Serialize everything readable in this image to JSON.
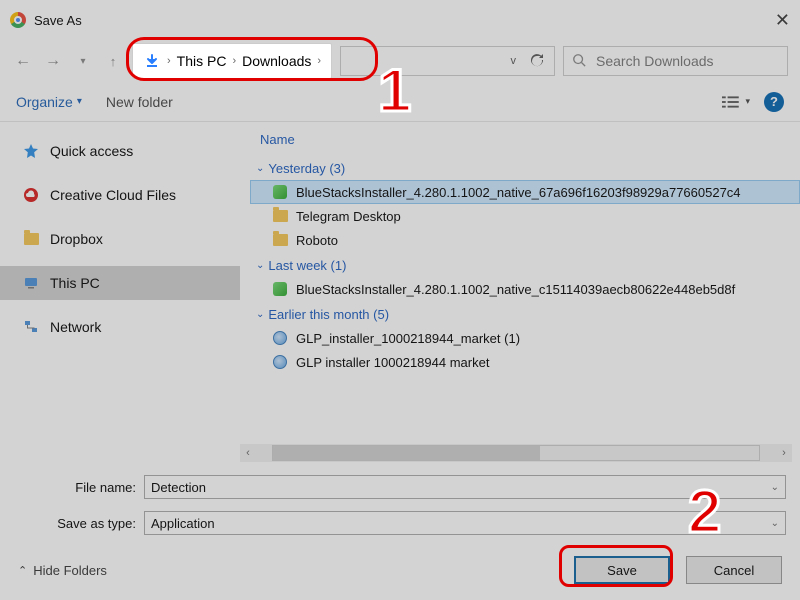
{
  "window": {
    "title": "Save As"
  },
  "breadcrumb": {
    "root": "This PC",
    "folder": "Downloads"
  },
  "search": {
    "placeholder": "Search Downloads"
  },
  "toolbar": {
    "organize": "Organize",
    "newfolder": "New folder"
  },
  "sidebar": {
    "items": [
      {
        "label": "Quick access",
        "icon": "star"
      },
      {
        "label": "Creative Cloud Files",
        "icon": "cc"
      },
      {
        "label": "Dropbox",
        "icon": "folder"
      },
      {
        "label": "This PC",
        "icon": "pc",
        "selected": true
      },
      {
        "label": "Network",
        "icon": "network"
      }
    ]
  },
  "list": {
    "column": "Name",
    "groups": [
      {
        "label": "Yesterday (3)",
        "items": [
          {
            "name": "BlueStacksInstaller_4.280.1.1002_native_67a696f16203f98929a77660527c4",
            "icon": "bluestacks",
            "selected": true
          },
          {
            "name": "Telegram Desktop",
            "icon": "folder"
          },
          {
            "name": "Roboto",
            "icon": "folder"
          }
        ]
      },
      {
        "label": "Last week (1)",
        "items": [
          {
            "name": "BlueStacksInstaller_4.280.1.1002_native_c15114039aecb80622e448eb5d8f",
            "icon": "bluestacks"
          }
        ]
      },
      {
        "label": "Earlier this month (5)",
        "items": [
          {
            "name": "GLP_installer_1000218944_market (1)",
            "icon": "glp"
          },
          {
            "name": "GLP installer 1000218944 market",
            "icon": "glp"
          }
        ]
      }
    ]
  },
  "fields": {
    "filename_label": "File name:",
    "filename_value": "Detection",
    "savetype_label": "Save as type:",
    "savetype_value": "Application"
  },
  "footer": {
    "hidefolders": "Hide Folders",
    "save": "Save",
    "cancel": "Cancel"
  },
  "callouts": {
    "one": "1",
    "two": "2"
  }
}
